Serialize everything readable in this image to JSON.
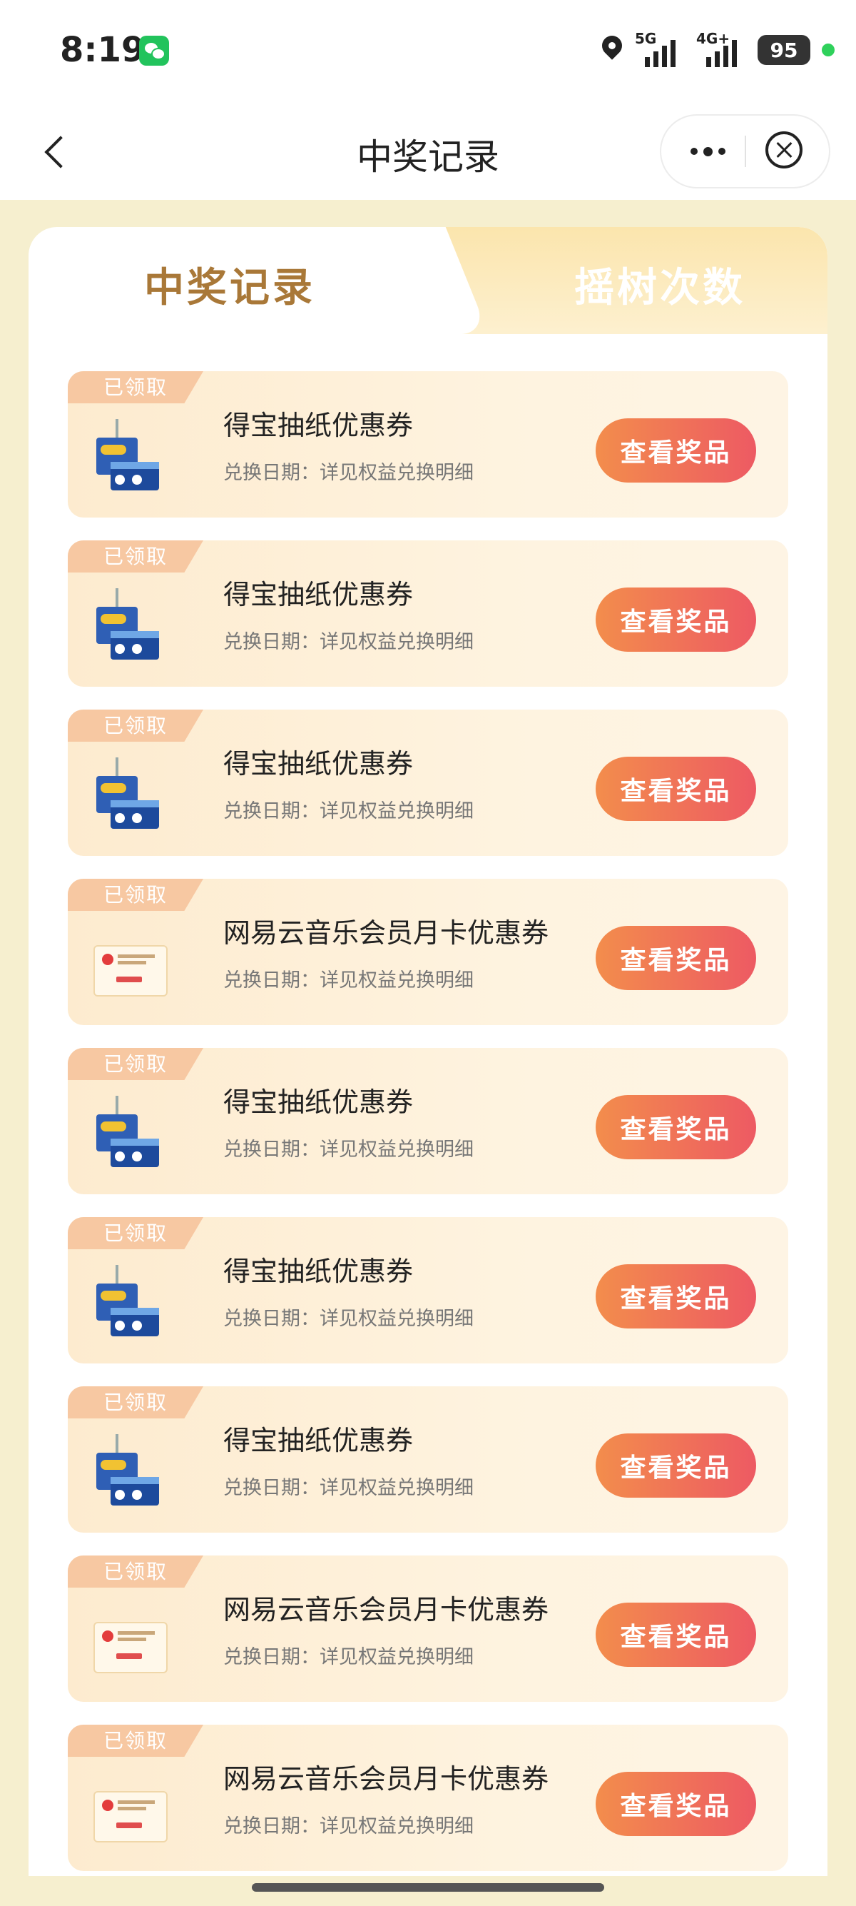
{
  "status_bar": {
    "time": "8:19",
    "network1": "5G",
    "network2": "4G+",
    "battery": "95"
  },
  "nav": {
    "title": "中奖记录"
  },
  "tabs": [
    {
      "label": "中奖记录",
      "active": true
    },
    {
      "label": "摇树次数",
      "active": false
    }
  ],
  "colors": {
    "accent_orange": "#f38d4c",
    "accent_red": "#ed5a63",
    "tab_active_text": "#a97838",
    "badge": "#f7c8a2"
  },
  "records": [
    {
      "badge": "已领取",
      "name": "得宝抽纸优惠券",
      "date_label": "兑换日期：详见权益兑换明细",
      "button": "查看奖品",
      "icon": "tissue-product-icon"
    },
    {
      "badge": "已领取",
      "name": "得宝抽纸优惠券",
      "date_label": "兑换日期：详见权益兑换明细",
      "button": "查看奖品",
      "icon": "tissue-product-icon"
    },
    {
      "badge": "已领取",
      "name": "得宝抽纸优惠券",
      "date_label": "兑换日期：详见权益兑换明细",
      "button": "查看奖品",
      "icon": "tissue-product-icon"
    },
    {
      "badge": "已领取",
      "name": "网易云音乐会员月卡优惠券",
      "date_label": "兑换日期：详见权益兑换明细",
      "button": "查看奖品",
      "icon": "music-voucher-icon"
    },
    {
      "badge": "已领取",
      "name": "得宝抽纸优惠券",
      "date_label": "兑换日期：详见权益兑换明细",
      "button": "查看奖品",
      "icon": "tissue-product-icon"
    },
    {
      "badge": "已领取",
      "name": "得宝抽纸优惠券",
      "date_label": "兑换日期：详见权益兑换明细",
      "button": "查看奖品",
      "icon": "tissue-product-icon"
    },
    {
      "badge": "已领取",
      "name": "得宝抽纸优惠券",
      "date_label": "兑换日期：详见权益兑换明细",
      "button": "查看奖品",
      "icon": "tissue-product-icon"
    },
    {
      "badge": "已领取",
      "name": "网易云音乐会员月卡优惠券",
      "date_label": "兑换日期：详见权益兑换明细",
      "button": "查看奖品",
      "icon": "music-voucher-icon"
    },
    {
      "badge": "已领取",
      "name": "网易云音乐会员月卡优惠券",
      "date_label": "兑换日期：详见权益兑换明细",
      "button": "查看奖品",
      "icon": "music-voucher-icon"
    }
  ]
}
